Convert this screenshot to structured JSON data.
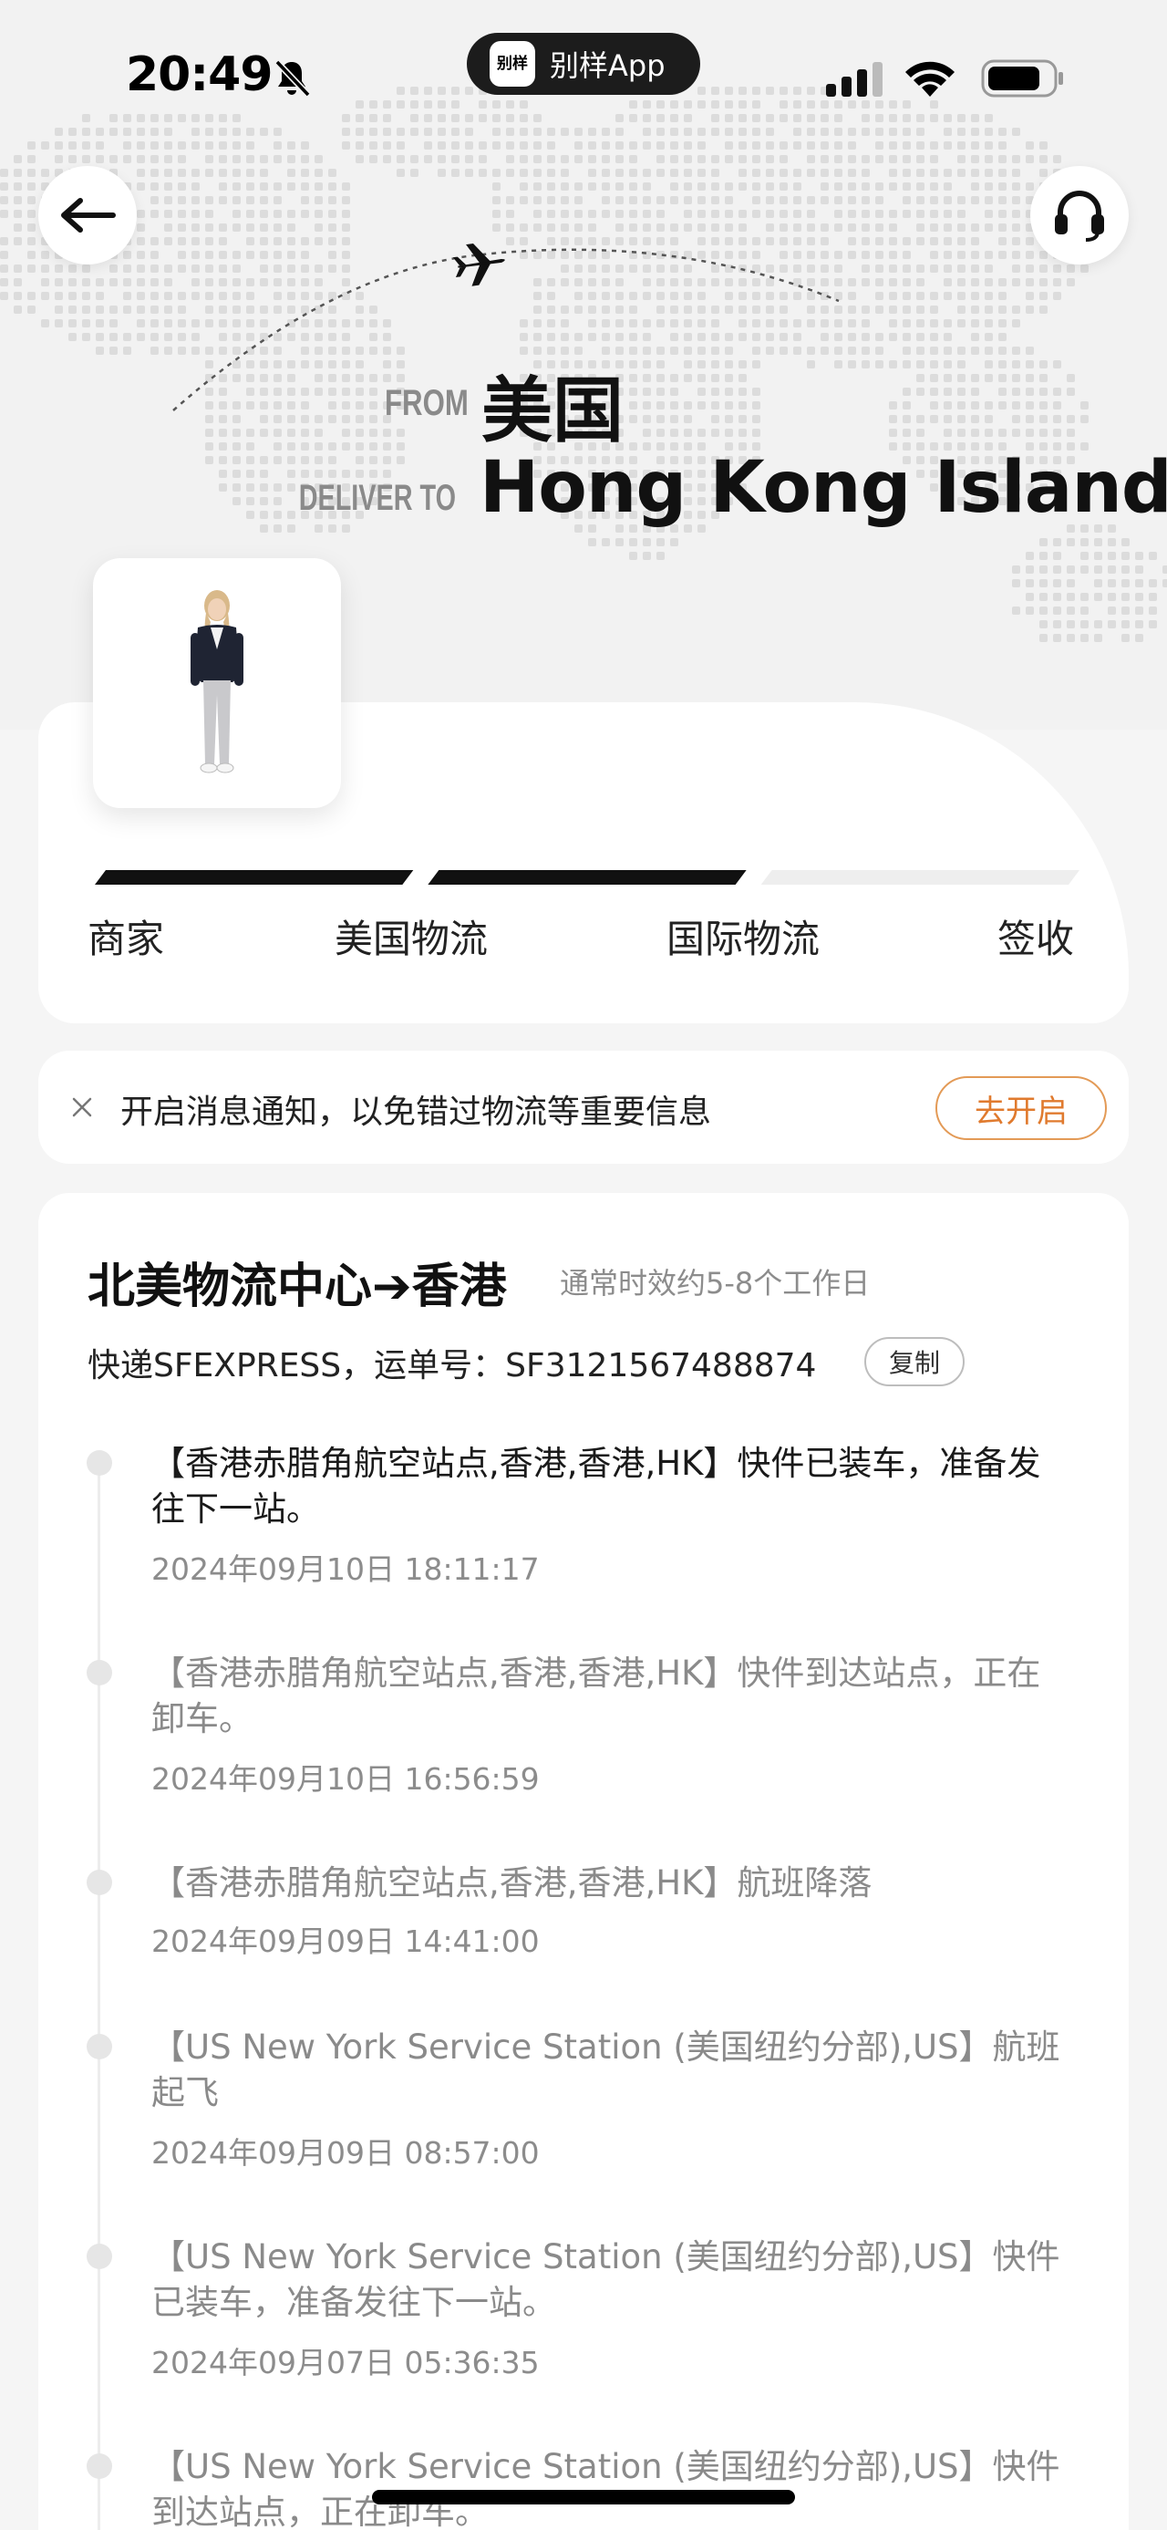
{
  "status_bar": {
    "time": "20:49",
    "app_logo_text": "别样",
    "app_name": "别样App",
    "icons": [
      "bell-slash-icon",
      "cellular-signal-icon",
      "wifi-icon",
      "battery-icon"
    ]
  },
  "header": {
    "back_icon": "arrow-left-icon",
    "service_icon": "headset-icon",
    "plane_icon": "airplane-icon"
  },
  "route": {
    "from_label": "FROM",
    "from_value": "美国",
    "to_label": "DELIVER TO",
    "to_value": "Hong Kong Island"
  },
  "progress": {
    "steps": [
      "商家",
      "美国物流",
      "国际物流",
      "签收"
    ],
    "completed_segments": 2,
    "total_segments": 3
  },
  "notification": {
    "text": "开启消息通知，以免错过物流等重要信息",
    "button_label": "去开启"
  },
  "tracking": {
    "title": "北美物流中心➔香港",
    "subtitle": "通常时效约5-8个工作日",
    "carrier_line": "快递SFEXPRESS，运单号：SF3121567488874",
    "copy_label": "复制",
    "events": [
      {
        "text": "【香港赤腊角航空站点,香港,香港,HK】快件已装车，准备发往下一站。",
        "time": "2024年09月10日 18:11:17"
      },
      {
        "text": "【香港赤腊角航空站点,香港,香港,HK】快件到达站点，正在卸车。",
        "time": "2024年09月10日 16:56:59"
      },
      {
        "text": "【香港赤腊角航空站点,香港,香港,HK】航班降落",
        "time": "2024年09月09日 14:41:00"
      },
      {
        "text": "【US New York Service Station (美国纽约分部),US】航班起飞",
        "time": "2024年09月09日 08:57:00"
      },
      {
        "text": "【US New York Service Station (美国纽约分部),US】快件已装车，准备发往下一站。",
        "time": "2024年09月07日 05:36:35"
      },
      {
        "text": "【US New York Service Station (美国纽约分部),US】快件到达站点，正在卸车。",
        "time": ""
      }
    ]
  },
  "colors": {
    "accent_orange": "#e07a2e",
    "progress_done": "#111111",
    "progress_todo": "#eeeeee"
  }
}
